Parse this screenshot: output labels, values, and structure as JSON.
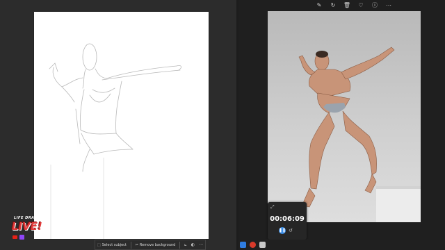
{
  "stream_logo": {
    "top_text": "LIFE DRAWING",
    "main_text": "LIVE!"
  },
  "photo_toolbar": {
    "icons": [
      "edit-icon",
      "rotate-icon",
      "delete-icon",
      "favorite-icon",
      "info-icon",
      "more-icon"
    ],
    "glyphs": [
      "✎",
      "↻",
      "🗑",
      "♡",
      "ⓘ",
      "⋯"
    ]
  },
  "timer": {
    "time": "00:06:09",
    "pause_glyph": "❚❚",
    "reset_glyph": "↺",
    "expand_glyph": "⤢"
  },
  "bottom_bar": {
    "select_subject_label": "Select subject",
    "remove_background_label": "Remove background",
    "select_glyph": "⬚",
    "remove_glyph": "✂",
    "crop_glyph": "⟀",
    "adjust_glyph": "◐",
    "more_glyph": "⋯"
  },
  "colors": {
    "accent": "#3b8ee8",
    "logo_red": "#e23b3b",
    "youtube_red": "#e62117",
    "twitch_purple": "#8f45f7"
  },
  "taskbar": {
    "icons": [
      "paint-app-icon",
      "red-app-icon",
      "clipboard-app-icon"
    ]
  }
}
